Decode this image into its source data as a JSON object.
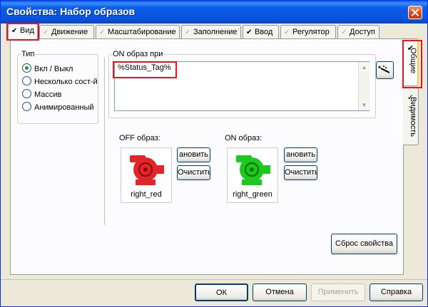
{
  "window": {
    "title": "Свойства: Набор образов"
  },
  "tabs": [
    {
      "label": "Вид",
      "checked": true
    },
    {
      "label": "Движение",
      "checked": false
    },
    {
      "label": "Масштабирование",
      "checked": false
    },
    {
      "label": "Заполнение",
      "checked": false
    },
    {
      "label": "Ввод",
      "checked": true
    },
    {
      "label": "Регулятор",
      "checked": false
    },
    {
      "label": "Доступ",
      "checked": false
    }
  ],
  "side_tabs": [
    {
      "label": "Общие",
      "checked": true
    },
    {
      "label": "Видимость",
      "checked": false
    }
  ],
  "type_group": {
    "legend": "Тип",
    "options": [
      "Вкл / Выкл",
      "Несколько сост-й",
      "Массив",
      "Анимированный"
    ],
    "selected": "Вкл / Выкл"
  },
  "on_expression": {
    "legend": "ON образ при",
    "value": "%Status_Tag%"
  },
  "off_image": {
    "label": "OFF образ:",
    "name": "right_red",
    "color": "#e0262b",
    "set_label": "ановить",
    "clear_label": "Очистить"
  },
  "on_image": {
    "label": "ON образ:",
    "name": "right_green",
    "color": "#1ec81e",
    "set_label": "ановить",
    "clear_label": "Очистить"
  },
  "reset_label": "Сброс свойства",
  "footer": {
    "ok": "ОК",
    "cancel": "Отмена",
    "apply": "Применить",
    "help": "Справка"
  },
  "colors": {
    "title_bar": "#0a55dd",
    "highlight": "#e8141b"
  },
  "icons": {
    "wizard": "magic-wand-icon",
    "check": "check-icon",
    "pump": "pump-icon"
  }
}
